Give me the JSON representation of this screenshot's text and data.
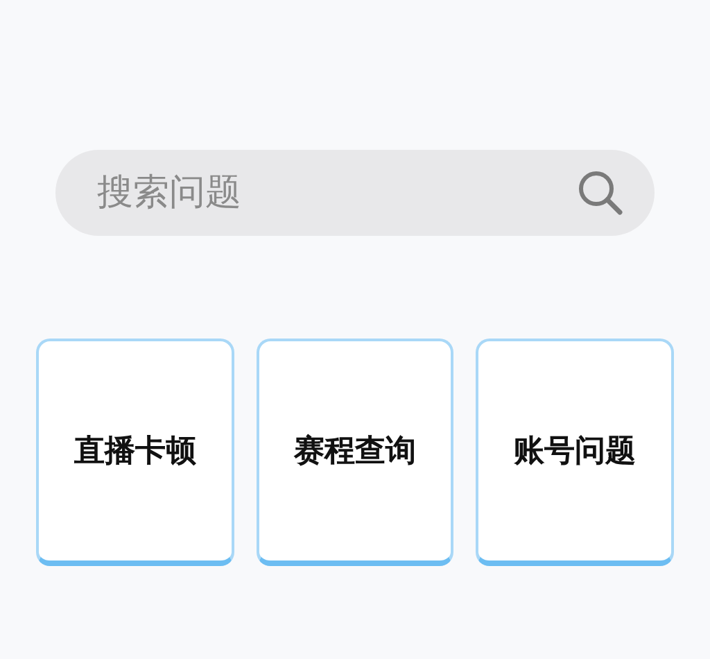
{
  "search": {
    "placeholder": "搜索问题"
  },
  "cards": [
    {
      "label": "直播卡顿"
    },
    {
      "label": "赛程查询"
    },
    {
      "label": "账号问题"
    }
  ]
}
